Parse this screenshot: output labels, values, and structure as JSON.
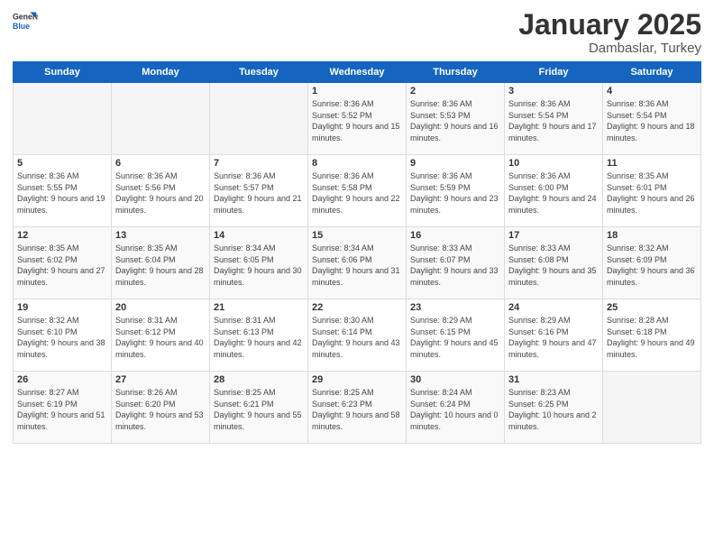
{
  "header": {
    "logo_general": "General",
    "logo_blue": "Blue",
    "month": "January 2025",
    "location": "Dambaslar, Turkey"
  },
  "weekdays": [
    "Sunday",
    "Monday",
    "Tuesday",
    "Wednesday",
    "Thursday",
    "Friday",
    "Saturday"
  ],
  "weeks": [
    [
      {
        "day": "",
        "sunrise": "",
        "sunset": "",
        "daylight": ""
      },
      {
        "day": "",
        "sunrise": "",
        "sunset": "",
        "daylight": ""
      },
      {
        "day": "",
        "sunrise": "",
        "sunset": "",
        "daylight": ""
      },
      {
        "day": "1",
        "sunrise": "Sunrise: 8:36 AM",
        "sunset": "Sunset: 5:52 PM",
        "daylight": "Daylight: 9 hours and 15 minutes."
      },
      {
        "day": "2",
        "sunrise": "Sunrise: 8:36 AM",
        "sunset": "Sunset: 5:53 PM",
        "daylight": "Daylight: 9 hours and 16 minutes."
      },
      {
        "day": "3",
        "sunrise": "Sunrise: 8:36 AM",
        "sunset": "Sunset: 5:54 PM",
        "daylight": "Daylight: 9 hours and 17 minutes."
      },
      {
        "day": "4",
        "sunrise": "Sunrise: 8:36 AM",
        "sunset": "Sunset: 5:54 PM",
        "daylight": "Daylight: 9 hours and 18 minutes."
      }
    ],
    [
      {
        "day": "5",
        "sunrise": "Sunrise: 8:36 AM",
        "sunset": "Sunset: 5:55 PM",
        "daylight": "Daylight: 9 hours and 19 minutes."
      },
      {
        "day": "6",
        "sunrise": "Sunrise: 8:36 AM",
        "sunset": "Sunset: 5:56 PM",
        "daylight": "Daylight: 9 hours and 20 minutes."
      },
      {
        "day": "7",
        "sunrise": "Sunrise: 8:36 AM",
        "sunset": "Sunset: 5:57 PM",
        "daylight": "Daylight: 9 hours and 21 minutes."
      },
      {
        "day": "8",
        "sunrise": "Sunrise: 8:36 AM",
        "sunset": "Sunset: 5:58 PM",
        "daylight": "Daylight: 9 hours and 22 minutes."
      },
      {
        "day": "9",
        "sunrise": "Sunrise: 8:36 AM",
        "sunset": "Sunset: 5:59 PM",
        "daylight": "Daylight: 9 hours and 23 minutes."
      },
      {
        "day": "10",
        "sunrise": "Sunrise: 8:36 AM",
        "sunset": "Sunset: 6:00 PM",
        "daylight": "Daylight: 9 hours and 24 minutes."
      },
      {
        "day": "11",
        "sunrise": "Sunrise: 8:35 AM",
        "sunset": "Sunset: 6:01 PM",
        "daylight": "Daylight: 9 hours and 26 minutes."
      }
    ],
    [
      {
        "day": "12",
        "sunrise": "Sunrise: 8:35 AM",
        "sunset": "Sunset: 6:02 PM",
        "daylight": "Daylight: 9 hours and 27 minutes."
      },
      {
        "day": "13",
        "sunrise": "Sunrise: 8:35 AM",
        "sunset": "Sunset: 6:04 PM",
        "daylight": "Daylight: 9 hours and 28 minutes."
      },
      {
        "day": "14",
        "sunrise": "Sunrise: 8:34 AM",
        "sunset": "Sunset: 6:05 PM",
        "daylight": "Daylight: 9 hours and 30 minutes."
      },
      {
        "day": "15",
        "sunrise": "Sunrise: 8:34 AM",
        "sunset": "Sunset: 6:06 PM",
        "daylight": "Daylight: 9 hours and 31 minutes."
      },
      {
        "day": "16",
        "sunrise": "Sunrise: 8:33 AM",
        "sunset": "Sunset: 6:07 PM",
        "daylight": "Daylight: 9 hours and 33 minutes."
      },
      {
        "day": "17",
        "sunrise": "Sunrise: 8:33 AM",
        "sunset": "Sunset: 6:08 PM",
        "daylight": "Daylight: 9 hours and 35 minutes."
      },
      {
        "day": "18",
        "sunrise": "Sunrise: 8:32 AM",
        "sunset": "Sunset: 6:09 PM",
        "daylight": "Daylight: 9 hours and 36 minutes."
      }
    ],
    [
      {
        "day": "19",
        "sunrise": "Sunrise: 8:32 AM",
        "sunset": "Sunset: 6:10 PM",
        "daylight": "Daylight: 9 hours and 38 minutes."
      },
      {
        "day": "20",
        "sunrise": "Sunrise: 8:31 AM",
        "sunset": "Sunset: 6:12 PM",
        "daylight": "Daylight: 9 hours and 40 minutes."
      },
      {
        "day": "21",
        "sunrise": "Sunrise: 8:31 AM",
        "sunset": "Sunset: 6:13 PM",
        "daylight": "Daylight: 9 hours and 42 minutes."
      },
      {
        "day": "22",
        "sunrise": "Sunrise: 8:30 AM",
        "sunset": "Sunset: 6:14 PM",
        "daylight": "Daylight: 9 hours and 43 minutes."
      },
      {
        "day": "23",
        "sunrise": "Sunrise: 8:29 AM",
        "sunset": "Sunset: 6:15 PM",
        "daylight": "Daylight: 9 hours and 45 minutes."
      },
      {
        "day": "24",
        "sunrise": "Sunrise: 8:29 AM",
        "sunset": "Sunset: 6:16 PM",
        "daylight": "Daylight: 9 hours and 47 minutes."
      },
      {
        "day": "25",
        "sunrise": "Sunrise: 8:28 AM",
        "sunset": "Sunset: 6:18 PM",
        "daylight": "Daylight: 9 hours and 49 minutes."
      }
    ],
    [
      {
        "day": "26",
        "sunrise": "Sunrise: 8:27 AM",
        "sunset": "Sunset: 6:19 PM",
        "daylight": "Daylight: 9 hours and 51 minutes."
      },
      {
        "day": "27",
        "sunrise": "Sunrise: 8:26 AM",
        "sunset": "Sunset: 6:20 PM",
        "daylight": "Daylight: 9 hours and 53 minutes."
      },
      {
        "day": "28",
        "sunrise": "Sunrise: 8:25 AM",
        "sunset": "Sunset: 6:21 PM",
        "daylight": "Daylight: 9 hours and 55 minutes."
      },
      {
        "day": "29",
        "sunrise": "Sunrise: 8:25 AM",
        "sunset": "Sunset: 6:23 PM",
        "daylight": "Daylight: 9 hours and 58 minutes."
      },
      {
        "day": "30",
        "sunrise": "Sunrise: 8:24 AM",
        "sunset": "Sunset: 6:24 PM",
        "daylight": "Daylight: 10 hours and 0 minutes."
      },
      {
        "day": "31",
        "sunrise": "Sunrise: 8:23 AM",
        "sunset": "Sunset: 6:25 PM",
        "daylight": "Daylight: 10 hours and 2 minutes."
      },
      {
        "day": "",
        "sunrise": "",
        "sunset": "",
        "daylight": ""
      }
    ]
  ]
}
